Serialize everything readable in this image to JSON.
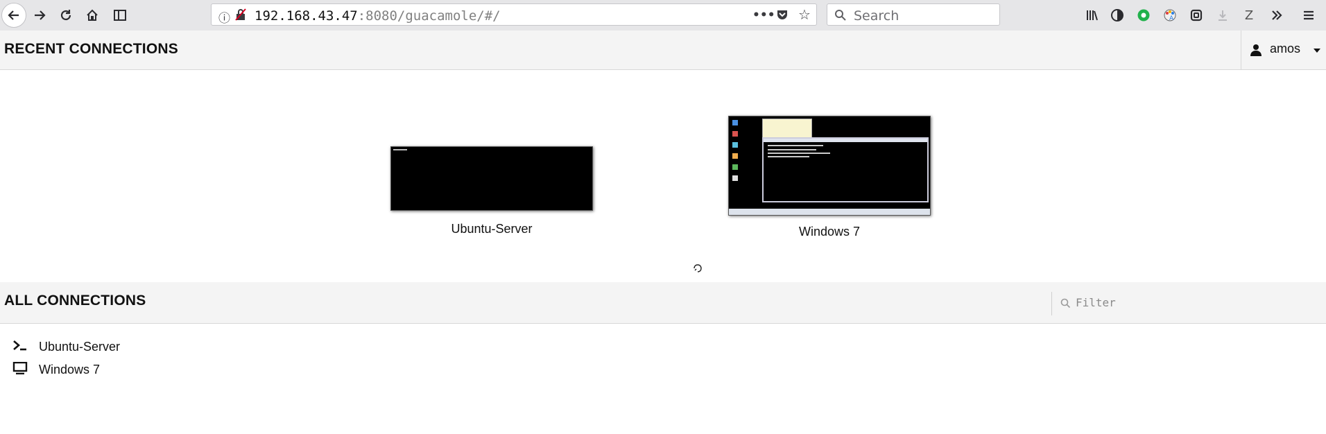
{
  "browser": {
    "url_host": "192.168.43.47",
    "url_rest": ":8080/guacamole/#/",
    "search_placeholder": "Search",
    "ext_z": "Z"
  },
  "recent": {
    "title": "RECENT CONNECTIONS",
    "user": "amos",
    "items": [
      {
        "label": "Ubuntu-Server"
      },
      {
        "label": "Windows 7"
      }
    ]
  },
  "all": {
    "title": "ALL CONNECTIONS",
    "filter_placeholder": "Filter",
    "items": [
      {
        "label": "Ubuntu-Server",
        "icon": "terminal-icon"
      },
      {
        "label": "Windows 7",
        "icon": "desktop-icon"
      }
    ]
  },
  "colors": {
    "accent": "#000000",
    "toolbar": "#e6e6e8",
    "header": "#f4f4f4"
  }
}
